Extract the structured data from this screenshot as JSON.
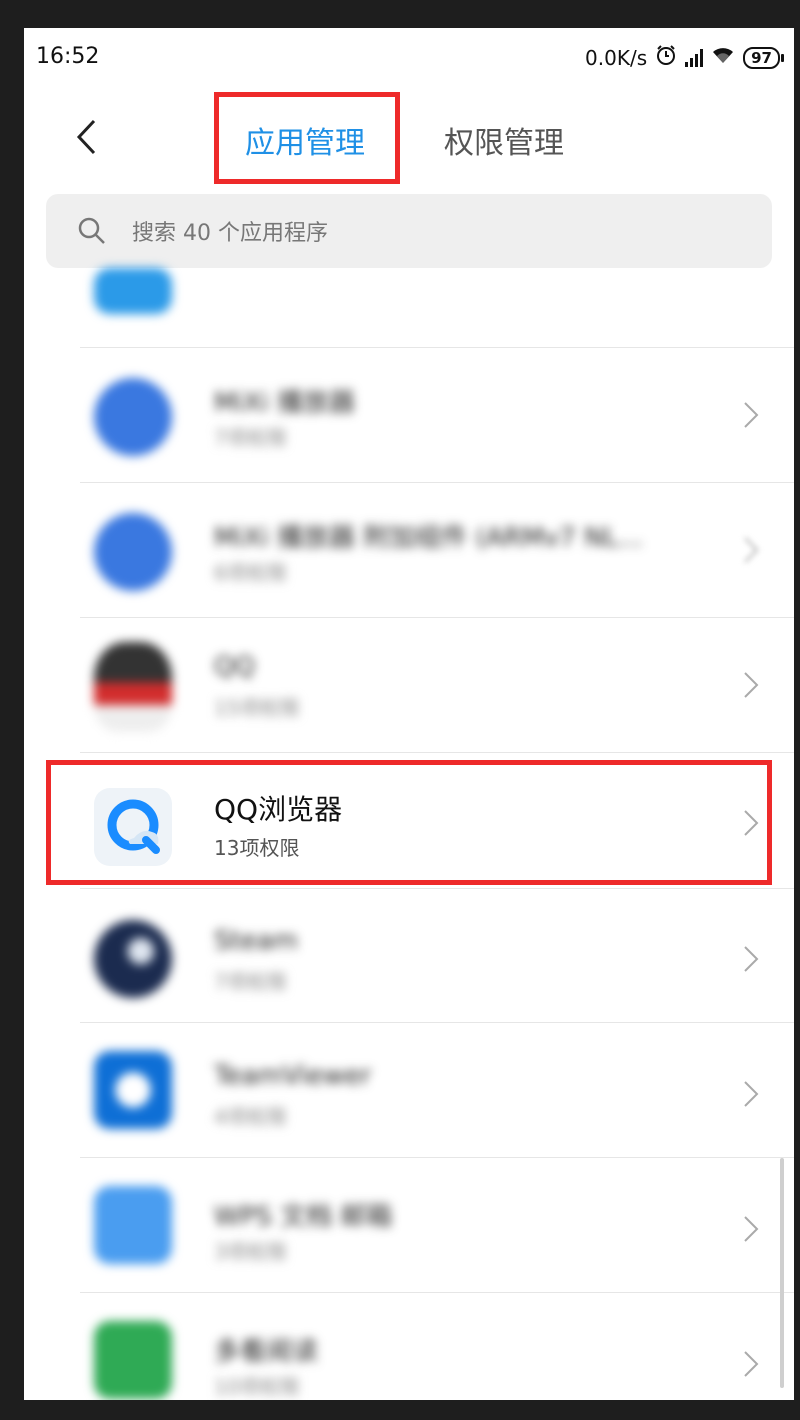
{
  "status_bar": {
    "time": "16:52",
    "network_speed": "0.0K/s",
    "battery": "97"
  },
  "header": {
    "tabs": [
      {
        "label": "应用管理",
        "active": true
      },
      {
        "label": "权限管理",
        "active": false
      }
    ]
  },
  "search": {
    "placeholder": "搜索 40 个应用程序"
  },
  "apps": [
    {
      "name": "",
      "sub": "",
      "icon": "blue-app-icon",
      "color": "#2b9ae8",
      "blurred": true
    },
    {
      "name": "MiXi 播放器",
      "sub": "7项权限",
      "icon": "blue-circle-app-icon",
      "color": "#3a78e0",
      "blurred": true
    },
    {
      "name": "MiXi 播放器 附加组件 (ARMv7 NL...",
      "sub": "6项权限",
      "icon": "blue-circle-app-icon",
      "color": "#3a78e0",
      "blurred": true
    },
    {
      "name": "QQ",
      "sub": "15项权限",
      "icon": "qq-penguin-icon",
      "color": "#d22d2d",
      "blurred": true
    },
    {
      "name": "QQ浏览器",
      "sub": "13项权限",
      "icon": "qq-browser-icon",
      "color": "#1a8cff",
      "blurred": false
    },
    {
      "name": "Steam",
      "sub": "7项权限",
      "icon": "steam-icon",
      "color": "#1b2b4f",
      "blurred": true
    },
    {
      "name": "TeamViewer",
      "sub": "4项权限",
      "icon": "teamviewer-icon",
      "color": "#0e6fd6",
      "blurred": true
    },
    {
      "name": "WPS 文档 邮箱",
      "sub": "3项权限",
      "icon": "blue-square-app-icon",
      "color": "#4a9df0",
      "blurred": true
    },
    {
      "name": "多看阅读",
      "sub": "10项权限",
      "icon": "green-app-icon",
      "color": "#2faa55",
      "blurred": true
    }
  ]
}
